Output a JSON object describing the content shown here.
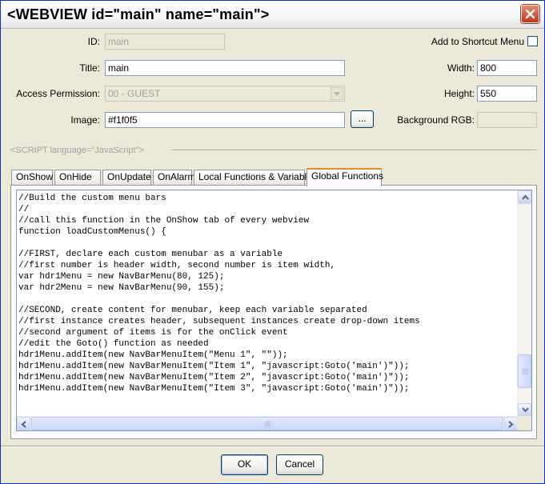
{
  "window": {
    "title": "<WEBVIEW id=\"main\" name=\"main\">",
    "close_icon": "close-icon"
  },
  "form": {
    "id_label": "ID:",
    "id_value": "main",
    "title_label": "Title:",
    "title_value": "main",
    "access_label": "Access Permission:",
    "access_value": "00 - GUEST",
    "image_label": "Image:",
    "image_value": "#f1f0f5",
    "browse_label": "...",
    "shortcut_label": "Add to Shortcut Menu",
    "shortcut_checked": false,
    "width_label": "Width:",
    "width_value": "800",
    "height_label": "Height:",
    "height_value": "550",
    "bg_label": "Background RGB:",
    "bg_value": ""
  },
  "script_header": "<SCRIPT language=\"JavaScript\">",
  "tabs": [
    {
      "label": "OnShow"
    },
    {
      "label": "OnHide"
    },
    {
      "label": "OnUpdate"
    },
    {
      "label": "OnAlarm"
    },
    {
      "label": "Local Functions & Variables"
    },
    {
      "label": "Global Functions"
    }
  ],
  "active_tab": "Global Functions",
  "editor": {
    "code": "//Build the custom menu bars\n//\n//call this function in the OnShow tab of every webview\nfunction loadCustomMenus() {\n\n//FIRST, declare each custom menubar as a variable\n//first number is header width, second number is item width,\nvar hdr1Menu = new NavBarMenu(80, 125);\nvar hdr2Menu = new NavBarMenu(90, 155);\n\n//SECOND, create content for menubar, keep each variable separated\n//first instance creates header, subsequent instances create drop-down items\n//second argument of items is for the onClick event\n//edit the Goto() function as needed\nhdr1Menu.addItem(new NavBarMenuItem(\"Menu 1\", \"\"));\nhdr1Menu.addItem(new NavBarMenuItem(\"Item 1\", \"javascript:Goto('main')\"));\nhdr1Menu.addItem(new NavBarMenuItem(\"Item 2\", \"javascript:Goto('main')\"));\nhdr1Menu.addItem(new NavBarMenuItem(\"Item 3\", \"javascript:Goto('main')\"));"
  },
  "buttons": {
    "ok": "OK",
    "cancel": "Cancel"
  },
  "colors": {
    "accent_tab": "#e68b2c",
    "close_button": "#c5361a",
    "dialog_bg": "#ece9d8"
  }
}
